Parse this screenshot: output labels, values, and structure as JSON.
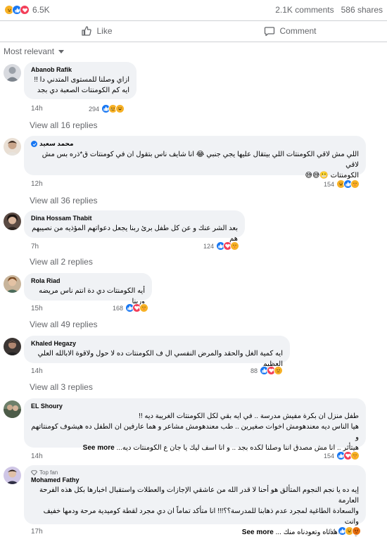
{
  "post": {
    "reaction_total": "6.5K",
    "comments": "2.1K comments",
    "shares": "586 shares",
    "like_label": "Like",
    "comment_label": "Comment",
    "sort_label": "Most relevant"
  },
  "comments": [
    {
      "author": "Abanob Rafik",
      "lines": [
        "ازاي وصلنا للمستوى المتدني دا !!",
        "ايه كم الكومنتات الصعبة دي بجد"
      ],
      "time": "14h",
      "reactions": "294",
      "view_replies": "View all 16 replies"
    },
    {
      "author": "محمد سعيد",
      "verified": true,
      "lines": [
        "اللي مش لاقي الكومنتات اللي بيتقال عليها يجي جنبي 😂 انا شايف ناس بتقول ان في كومنتات ق*ذره بس مش لاقي",
        "الكومنتات 😬😅😅"
      ],
      "time": "12h",
      "reactions": "154",
      "view_replies": "View all 36 replies"
    },
    {
      "author": "Dina Hossam Thabit",
      "lines": [
        "بعد الشر عنك و عن كل طفل برئ ربنا يجعل دعواتهم المؤذيه من نصيبهم هم"
      ],
      "time": "7h",
      "reactions": "124",
      "view_replies": "View all 2 replies"
    },
    {
      "author": "Rola Riad",
      "lines": [
        "أيه الكومنتات دي دة انتم ناس مريضه وربنا"
      ],
      "time": "15h",
      "reactions": "168",
      "view_replies": "View all 49 replies"
    },
    {
      "author": "Khaled Hegazy",
      "lines": [
        "ايه كمية الغل والحقد والمرض النفسي ال ف الكومنتات ده لا حول ولاقوة الابالله العلي العظيم"
      ],
      "time": "14h",
      "reactions": "88",
      "view_replies": "View all 3 replies"
    },
    {
      "author": "EL Shoury",
      "lines": [
        "طفل منزل ان بكرة مفيش مدرسة .. في ايه بقي لكل الكومنتات الغريبة ديه !!",
        "هيا الناس ديه معندهومش اخوات صغيرين .. طب معندهومش مشاعر و هما عارفين ان الطفل ده هيشوف كومنتاتهم و",
        "هيتأثر .. انا مش مصدق اننا وصلنا لكده بجد .. و انا اسف ليك يا جان ع الكومنتات ديه..."
      ],
      "see_more": "See more",
      "time": "14h",
      "reactions": "154"
    },
    {
      "author": "Mohamed Fathy",
      "top_fan": "Top fan",
      "lines": [
        "إيه ده يا نجم النجوم المتألق هو أحنا لا قدر الله من عاشقي الإجازات والعطلات واستقبال اخبارها بكل هذه الفرحة العارمة",
        "والسعادة الطاغية لمجرد عدم ذهابنا للمدرسة؟؟!!! انا متأكد تماماً ان دي مجرد لقطة كوميدية مرحة ودمها خفيف وانت",
        "وكما عاهدناه وتعودناه منك ..."
      ],
      "see_more": "See more",
      "time": "17h",
      "reactions": "64"
    }
  ],
  "colors": {
    "like": "#1877f2",
    "love": "#f33e58",
    "haha": "#f7b125",
    "angry": "#e9710f",
    "bubble": "#f0f2f5",
    "muted": "#65676b"
  }
}
